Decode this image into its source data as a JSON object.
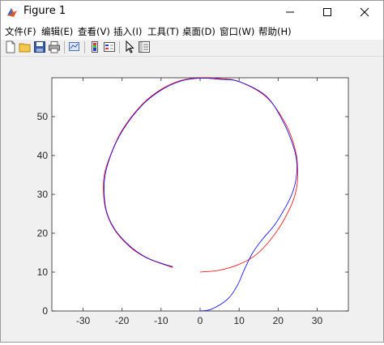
{
  "window": {
    "title": "Figure 1",
    "app_icon": "matlab-figure-icon"
  },
  "controls": {
    "minimize": "minimize-icon",
    "maximize": "maximize-icon",
    "close": "close-icon"
  },
  "menu": [
    "文件(F)",
    "编辑(E)",
    "查看(V)",
    "插入(I)",
    "工具(T)",
    "桌面(D)",
    "窗口(W)",
    "帮助(H)"
  ],
  "toolbar": [
    "new-figure-icon",
    "open-file-icon",
    "save-icon",
    "print-icon",
    "link-plot-icon",
    "insert-colorbar-icon",
    "insert-legend-icon",
    "edit-plot-icon",
    "property-inspector-icon"
  ],
  "colors": {
    "red_series": "#ff0000",
    "blue_series": "#0000ff"
  },
  "chart_data": {
    "type": "line",
    "xlim": [
      -38,
      38
    ],
    "ylim": [
      0,
      60
    ],
    "xticks": [
      -30,
      -20,
      -10,
      0,
      10,
      20,
      30
    ],
    "yticks": [
      0,
      10,
      20,
      30,
      40,
      50
    ],
    "grid": false,
    "series": [
      {
        "color": "#ff0000",
        "x": [
          0,
          5,
          10,
          15,
          20,
          23.5,
          24.8,
          25,
          24.5,
          22,
          17,
          10,
          5,
          0,
          -5,
          -10,
          -15,
          -20,
          -23,
          -24.7,
          -24.3,
          -22,
          -18,
          -14,
          -10,
          -7
        ],
        "y": [
          10,
          10.5,
          12,
          15,
          21,
          27.5,
          32,
          36,
          41,
          48,
          55,
          59,
          59.8,
          60,
          59.3,
          57,
          53,
          46.5,
          40,
          34,
          26.5,
          21,
          16.5,
          13.8,
          12.2,
          11.2
        ]
      },
      {
        "color": "#0000ff",
        "x": [
          0,
          3,
          7,
          9.5,
          11.5,
          13.5,
          16,
          19,
          21.5,
          23.5,
          24.6,
          24.8,
          24,
          21.5,
          17,
          10,
          5,
          0,
          -5,
          -10,
          -15,
          -20,
          -23,
          -24.5,
          -24.2,
          -22,
          -18,
          -14,
          -10,
          -7
        ],
        "y": [
          0,
          0.5,
          3,
          6.5,
          11,
          15,
          18.5,
          22,
          26,
          30,
          34,
          38,
          42,
          48.3,
          55.2,
          59,
          59.6,
          59.9,
          59.1,
          56.8,
          52.8,
          46.2,
          39.8,
          33.8,
          26.5,
          21.2,
          16.7,
          13.9,
          12.3,
          11.4
        ]
      }
    ]
  }
}
